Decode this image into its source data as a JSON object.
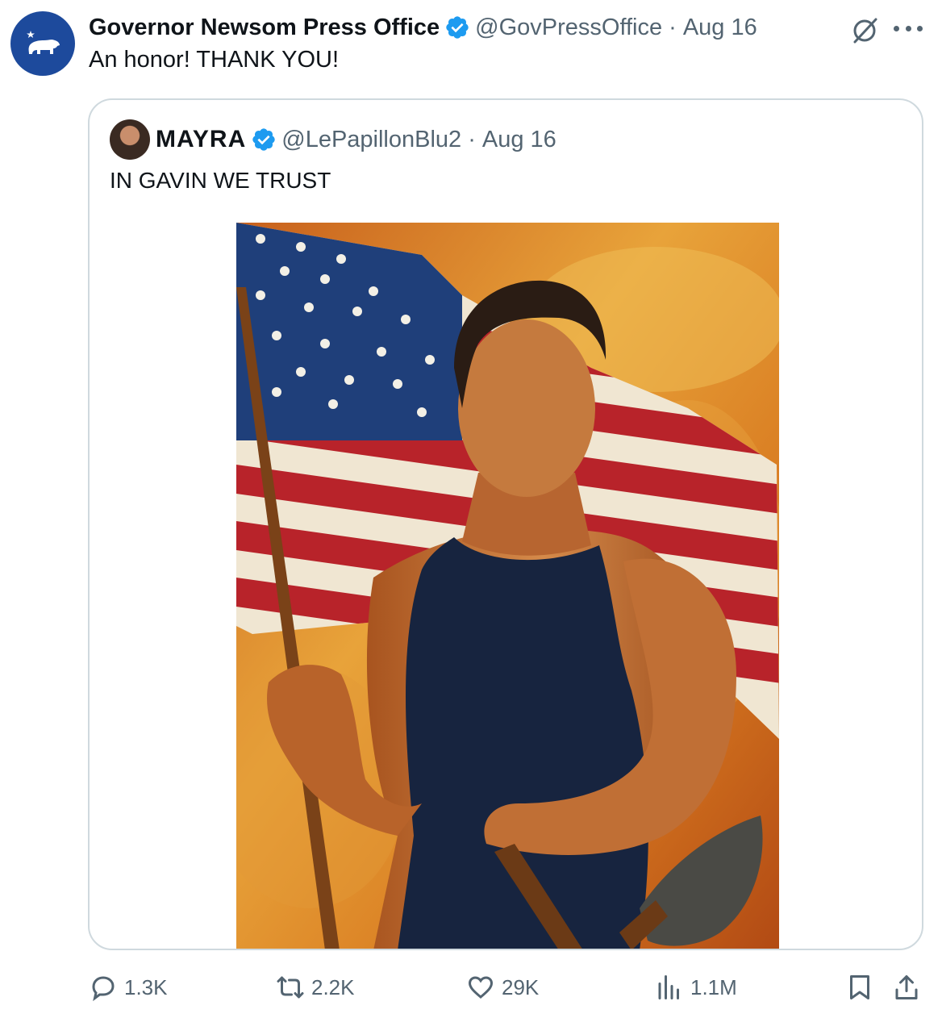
{
  "tweet": {
    "display_name": "Governor Newsom Press Office",
    "handle": "@GovPressOffice",
    "separator": "·",
    "date": "Aug 16",
    "text": "An honor! THANK YOU!",
    "avatar_icon": "california-bear-icon",
    "verified_icon": "verified-badge-icon",
    "accent_color": "#1d9bf0",
    "avatar_color": "#1d4a9c"
  },
  "quoted_tweet": {
    "display_name": "MAYRA",
    "handle": "@LePapillonBlu2",
    "separator": "·",
    "date": "Aug 16",
    "text": "IN GAVIN WE TRUST",
    "image_icon": "painting-image-icon"
  },
  "actions": {
    "replies": "1.3K",
    "reposts": "2.2K",
    "likes": "29K",
    "views": "1.1M"
  }
}
